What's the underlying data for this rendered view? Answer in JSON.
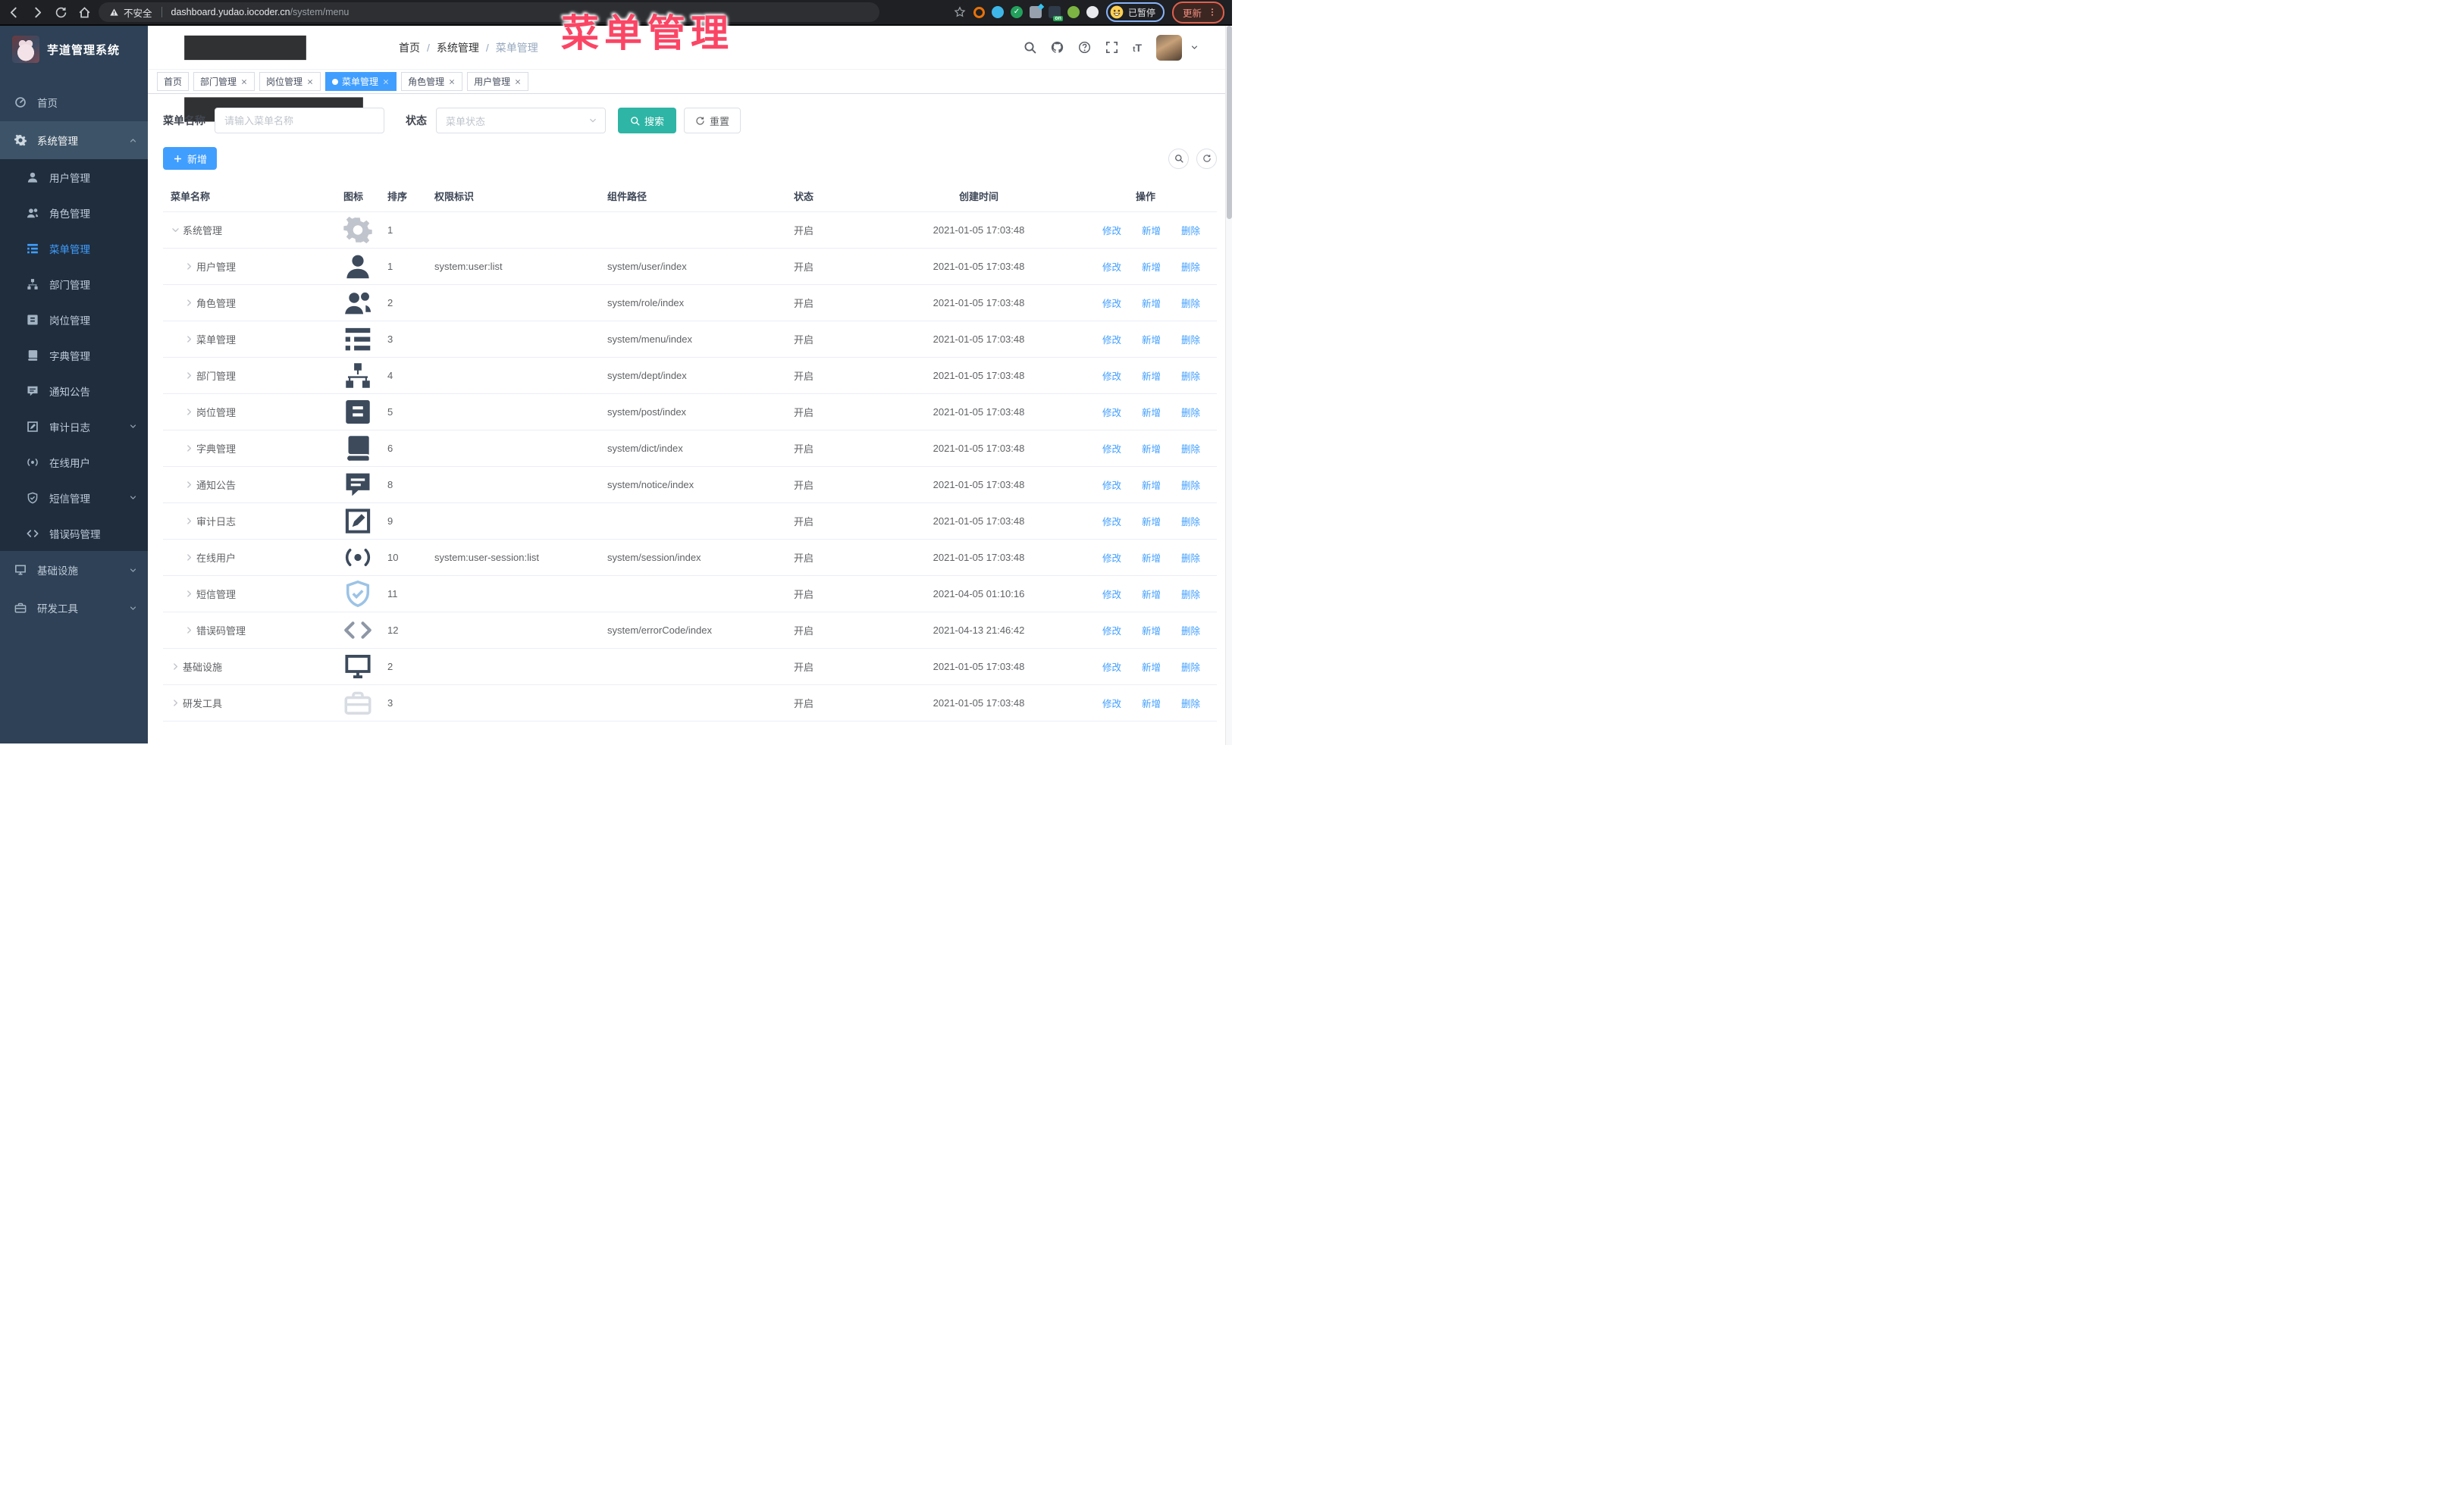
{
  "browser": {
    "security_label": "不安全",
    "url_host": "dashboard.yudao.iocoder.cn",
    "url_path": "/system/menu",
    "profile_badge": "已暂停",
    "update_button": "更新",
    "nav_icons": [
      "arrow-left",
      "arrow-right",
      "refresh",
      "home"
    ],
    "extensions": [
      {
        "name": "ext-orange-ring",
        "shape": "ring",
        "color": "#e8710a"
      },
      {
        "name": "ext-blue-drop",
        "shape": "circle",
        "color": "#3fb6e8"
      },
      {
        "name": "ext-green-check",
        "shape": "check",
        "color": "#23a15c",
        "glyph": "✓"
      },
      {
        "name": "ext-grid",
        "shape": "grid",
        "color": "#97a0ad",
        "accent": "#35c3f0"
      },
      {
        "name": "ext-on-badge",
        "shape": "badge",
        "color": "#2f3b4a",
        "badge": "on",
        "badge_color": "#23a855"
      },
      {
        "name": "ext-green-key",
        "shape": "circle",
        "color": "#7cb342"
      },
      {
        "name": "ext-puzzle",
        "shape": "circle",
        "color": "#e8eaed"
      }
    ]
  },
  "overlay": {
    "title": "菜单管理",
    "color": "#fb4565"
  },
  "sidebar": {
    "logo_title": "芋道管理系统",
    "menu": [
      {
        "label": "首页",
        "icon": "dashboard",
        "type": "top"
      },
      {
        "label": "系统管理",
        "icon": "gear",
        "type": "top",
        "open": true,
        "chevron": "up"
      },
      {
        "label": "用户管理",
        "icon": "user",
        "type": "sub"
      },
      {
        "label": "角色管理",
        "icon": "peoples",
        "type": "sub"
      },
      {
        "label": "菜单管理",
        "icon": "tree-table",
        "type": "sub",
        "active": true
      },
      {
        "label": "部门管理",
        "icon": "tree",
        "type": "sub"
      },
      {
        "label": "岗位管理",
        "icon": "post",
        "type": "sub"
      },
      {
        "label": "字典管理",
        "icon": "dict",
        "type": "sub"
      },
      {
        "label": "通知公告",
        "icon": "message",
        "type": "sub"
      },
      {
        "label": "审计日志",
        "icon": "log",
        "type": "sub",
        "chevron": "down"
      },
      {
        "label": "在线用户",
        "icon": "online",
        "type": "sub"
      },
      {
        "label": "短信管理",
        "icon": "sms",
        "type": "sub",
        "chevron": "down"
      },
      {
        "label": "错误码管理",
        "icon": "code",
        "type": "sub"
      },
      {
        "label": "基础设施",
        "icon": "monitor",
        "type": "top",
        "chevron": "down"
      },
      {
        "label": "研发工具",
        "icon": "tool",
        "type": "top",
        "chevron": "down"
      }
    ]
  },
  "navbar": {
    "breadcrumb": [
      "首页",
      "系统管理",
      "菜单管理"
    ],
    "right_icons": [
      "search",
      "github",
      "question",
      "fullscreen",
      "text-size"
    ]
  },
  "tabs": [
    {
      "label": "首页",
      "closable": false,
      "active": false
    },
    {
      "label": "部门管理",
      "closable": true,
      "active": false
    },
    {
      "label": "岗位管理",
      "closable": true,
      "active": false
    },
    {
      "label": "菜单管理",
      "closable": true,
      "active": true
    },
    {
      "label": "角色管理",
      "closable": true,
      "active": false
    },
    {
      "label": "用户管理",
      "closable": true,
      "active": false
    }
  ],
  "search": {
    "name_label": "菜单名称",
    "name_placeholder": "请输入菜单名称",
    "status_label": "状态",
    "status_placeholder": "菜单状态",
    "search_button": "搜索",
    "reset_button": "重置"
  },
  "toolbar": {
    "add_button": "新增"
  },
  "table": {
    "columns": [
      "菜单名称",
      "图标",
      "排序",
      "权限标识",
      "组件路径",
      "状态",
      "创建时间",
      "操作"
    ],
    "actions": {
      "edit": "修改",
      "add": "新增",
      "delete": "删除"
    },
    "rows": [
      {
        "name": "系统管理",
        "depth": 0,
        "caret": "down",
        "icon": "gear",
        "icon_color": "#c0c4cc",
        "sort": "1",
        "perms": "",
        "path": "",
        "status": "开启",
        "time": "2021-01-05 17:03:48"
      },
      {
        "name": "用户管理",
        "depth": 1,
        "caret": "right",
        "icon": "user",
        "icon_color": "#3c4a5c",
        "sort": "1",
        "perms": "system:user:list",
        "path": "system/user/index",
        "status": "开启",
        "time": "2021-01-05 17:03:48"
      },
      {
        "name": "角色管理",
        "depth": 1,
        "caret": "right",
        "icon": "peoples",
        "icon_color": "#3c4a5c",
        "sort": "2",
        "perms": "",
        "path": "system/role/index",
        "status": "开启",
        "time": "2021-01-05 17:03:48"
      },
      {
        "name": "菜单管理",
        "depth": 1,
        "caret": "right",
        "icon": "tree-table",
        "icon_color": "#3c4a5c",
        "sort": "3",
        "perms": "",
        "path": "system/menu/index",
        "status": "开启",
        "time": "2021-01-05 17:03:48"
      },
      {
        "name": "部门管理",
        "depth": 1,
        "caret": "right",
        "icon": "tree",
        "icon_color": "#3c4a5c",
        "sort": "4",
        "perms": "",
        "path": "system/dept/index",
        "status": "开启",
        "time": "2021-01-05 17:03:48"
      },
      {
        "name": "岗位管理",
        "depth": 1,
        "caret": "right",
        "icon": "post",
        "icon_color": "#3c4a5c",
        "sort": "5",
        "perms": "",
        "path": "system/post/index",
        "status": "开启",
        "time": "2021-01-05 17:03:48"
      },
      {
        "name": "字典管理",
        "depth": 1,
        "caret": "right",
        "icon": "dict",
        "icon_color": "#3c4a5c",
        "sort": "6",
        "perms": "",
        "path": "system/dict/index",
        "status": "开启",
        "time": "2021-01-05 17:03:48"
      },
      {
        "name": "通知公告",
        "depth": 1,
        "caret": "right",
        "icon": "message",
        "icon_color": "#3c4a5c",
        "sort": "8",
        "perms": "",
        "path": "system/notice/index",
        "status": "开启",
        "time": "2021-01-05 17:03:48"
      },
      {
        "name": "审计日志",
        "depth": 1,
        "caret": "right",
        "icon": "log",
        "icon_color": "#3c4a5c",
        "sort": "9",
        "perms": "",
        "path": "",
        "status": "开启",
        "time": "2021-01-05 17:03:48"
      },
      {
        "name": "在线用户",
        "depth": 1,
        "caret": "right",
        "icon": "online",
        "icon_color": "#3c4a5c",
        "sort": "10",
        "perms": "system:user-session:list",
        "path": "system/session/index",
        "status": "开启",
        "time": "2021-01-05 17:03:48"
      },
      {
        "name": "短信管理",
        "depth": 1,
        "caret": "right",
        "icon": "sms",
        "icon_color": "#9cc3e6",
        "sort": "11",
        "perms": "",
        "path": "",
        "status": "开启",
        "time": "2021-04-05 01:10:16"
      },
      {
        "name": "错误码管理",
        "depth": 1,
        "caret": "right",
        "icon": "code",
        "icon_color": "#8d97a5",
        "sort": "12",
        "perms": "",
        "path": "system/errorCode/index",
        "status": "开启",
        "time": "2021-04-13 21:46:42"
      },
      {
        "name": "基础设施",
        "depth": 0,
        "caret": "right",
        "icon": "monitor",
        "icon_color": "#3c4a5c",
        "sort": "2",
        "perms": "",
        "path": "",
        "status": "开启",
        "time": "2021-01-05 17:03:48"
      },
      {
        "name": "研发工具",
        "depth": 0,
        "caret": "right",
        "icon": "tool",
        "icon_color": "#d8dce3",
        "sort": "3",
        "perms": "",
        "path": "",
        "status": "开启",
        "time": "2021-01-05 17:03:48"
      }
    ]
  },
  "colors": {
    "accent": "#409eff",
    "teal": "#2eb5a5",
    "sidebar_bg": "#2e4156",
    "submenu_bg": "#1f2d3d"
  }
}
